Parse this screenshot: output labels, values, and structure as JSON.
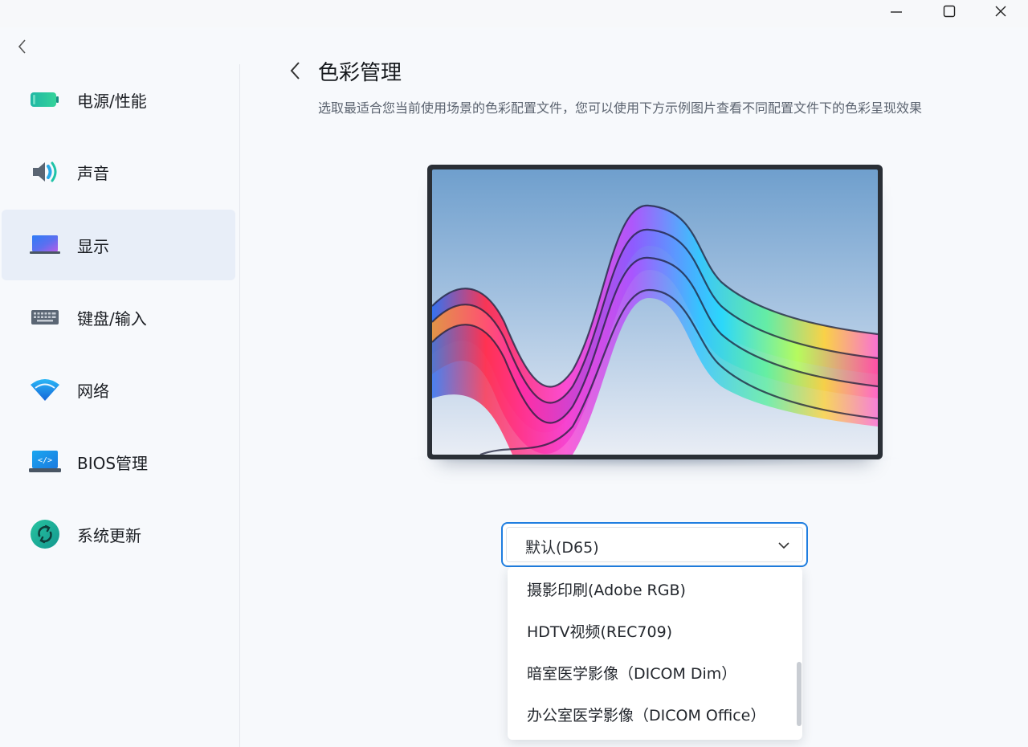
{
  "window": {
    "minimize_icon": "minimize-icon",
    "maximize_icon": "maximize-icon",
    "close_icon": "close-icon"
  },
  "sidebar": {
    "items": [
      {
        "label": "电源/性能",
        "icon": "battery-icon",
        "active": false
      },
      {
        "label": "声音",
        "icon": "speaker-icon",
        "active": false
      },
      {
        "label": "显示",
        "icon": "monitor-icon",
        "active": true
      },
      {
        "label": "键盘/输入",
        "icon": "keyboard-icon",
        "active": false
      },
      {
        "label": "网络",
        "icon": "wifi-icon",
        "active": false
      },
      {
        "label": "BIOS管理",
        "icon": "bios-code-icon",
        "active": false
      },
      {
        "label": "系统更新",
        "icon": "refresh-icon",
        "active": false
      }
    ]
  },
  "main": {
    "title": "色彩管理",
    "description": "选取最适合您当前使用场景的色彩配置文件，您可以使用下方示例图片查看不同配置文件下的色彩呈现效果",
    "preview_icon": "monitor-preview-image"
  },
  "color_profile": {
    "selected": "默认(D65)",
    "options": [
      "摄影印刷(Adobe RGB)",
      "HDTV视频(REC709)",
      "暗室医学影像（DICOM Dim）",
      "办公室医学影像（DICOM Office）"
    ],
    "accent": "#1f7ee0"
  }
}
